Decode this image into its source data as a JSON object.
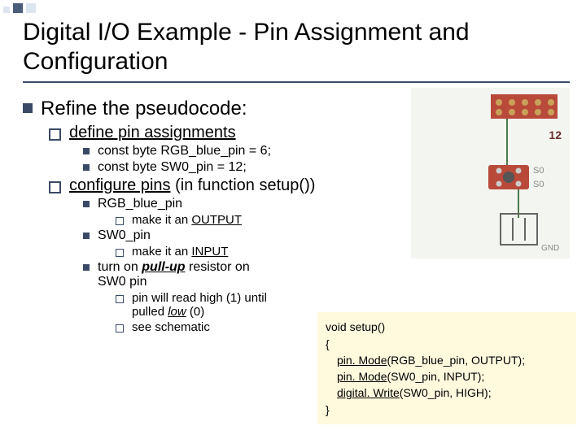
{
  "title": "Digital I/O Example - Pin Assignment and Configuration",
  "heading": "Refine the pseudocode:",
  "sec1": {
    "label": "define pin assignments",
    "line1": "const byte RGB_blue_pin = 6;",
    "line2": "const byte SW0_pin = 12;"
  },
  "sec2": {
    "label_a": "configure pins",
    "label_b": " (in function setup())",
    "item1": {
      "name": "RGB_blue_pin",
      "make_prefix": "make it an ",
      "make_val": "OUTPUT"
    },
    "item2": {
      "name": "SW0_pin",
      "make_prefix": "make it an ",
      "make_val": "INPUT"
    },
    "item3": {
      "pre": "turn on ",
      "bold": "pull-up",
      "post": " resistor on SW0 pin",
      "sub1a": "pin will read high (1) until pulled ",
      "sub1b": "low",
      "sub1c": " (0)",
      "sub2": "see schematic"
    }
  },
  "code": {
    "l1": "void setup()",
    "l2": "{",
    "l3a": "pin. Mode",
    "l3b": "(RGB_blue_pin, OUTPUT);",
    "l4a": "pin. Mode",
    "l4b": "(SW0_pin, INPUT);",
    "l5a": "digital. Write",
    "l5b": "(SW0_pin, HIGH);",
    "l6": "}"
  },
  "schematic": {
    "pin_label": "12",
    "btn1": "S0",
    "btn2": "S0",
    "gnd": "GND"
  }
}
